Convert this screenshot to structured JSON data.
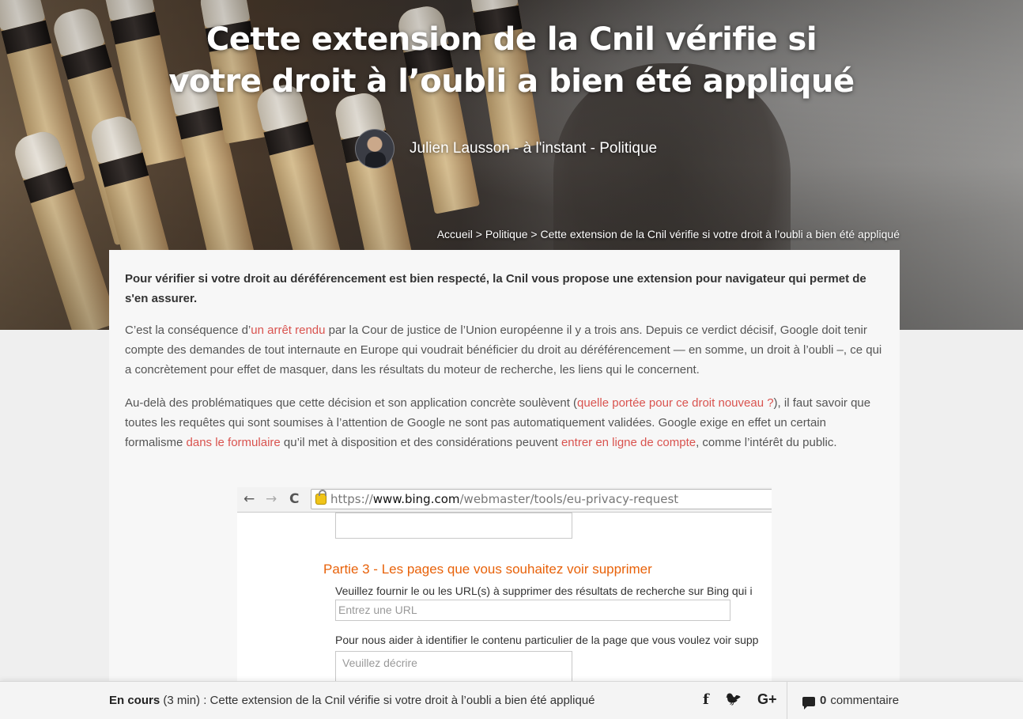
{
  "article": {
    "title_line1": "Cette extension de la Cnil vérifie si",
    "title_line2": "votre droit à l’oubli a bien été appliqué",
    "byline": "Julien Lausson - à l'instant - Politique",
    "breadcrumb": {
      "home": "Accueil",
      "sep1": " > ",
      "section": "Politique",
      "sep2": " > ",
      "current": "Cette extension de la Cnil vérifie si votre droit à l’oubli a bien été appliqué"
    },
    "lead": "Pour vérifier si votre droit au déréférencement est bien respecté, la Cnil vous propose une extension pour navigateur qui permet de s'en assurer.",
    "p1": {
      "t1": "C’est la conséquence d’",
      "link1": "un arrêt rendu",
      "t2": " par la Cour de justice de l’Union européenne il y a trois ans. Depuis ce verdict décisif, Google doit tenir compte des demandes de tout internaute en Europe qui voudrait bénéficier du droit au déréférencement — en somme, un droit à l’oubli –, ce qui a concrètement pour effet de masquer, dans les résultats du moteur de recherche, les liens qui le concernent."
    },
    "p2": {
      "t1": "Au-delà des problématiques que cette décision et son application concrète soulèvent (",
      "link1": "quelle portée pour ce droit nouveau ?",
      "t2": "), il faut savoir que toutes les requêtes qui sont soumises à l’attention de Google ne sont pas automatiquement validées. Google exige en effet un certain formalisme ",
      "link2": "dans le formulaire",
      "t3": " qu’il met à disposition et des considérations peuvent ",
      "link3": "entrer en ligne de compte",
      "t4": ", comme l’intérêt du public."
    }
  },
  "screenshot": {
    "url_scheme": "https://",
    "url_host": "www.bing.com",
    "url_path": "/webmaster/tools/eu-privacy-request",
    "part_title": "Partie 3 - Les pages que vous souhaitez voir supprimer",
    "instruction1": "Veuillez fournir le ou les URL(s) à supprimer des résultats de recherche sur Bing qui i",
    "url_placeholder": "Entrez une URL",
    "instruction2": "Pour nous aider à identifier le contenu particulier de la page que vous voulez voir supp",
    "describe_placeholder": "Veuillez décrire"
  },
  "bottombar": {
    "status": "En cours",
    "duration": " (3 min)",
    "separator": " : ",
    "current_title": "Cette extension de la Cnil vérifie si votre droit à l’oubli a bien été appliqué",
    "facebook": "f",
    "twitter": "🐦",
    "gplus": "G+",
    "comment_count": "0",
    "comment_label": "commentaire"
  },
  "icons": {
    "back": "←",
    "forward": "→",
    "reload": "C"
  }
}
